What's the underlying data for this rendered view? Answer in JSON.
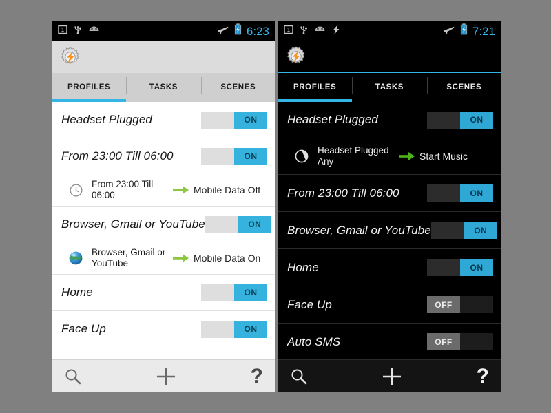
{
  "app": {
    "name": "Tasker",
    "logo_icon": "tasker-gear-bolt-icon"
  },
  "panels": [
    {
      "id": "light",
      "theme": "light",
      "status_bar": {
        "left_icons": [
          "sim-card-icon",
          "usb-icon",
          "android-debug-icon"
        ],
        "right_icons": [
          "airplane-mode-icon",
          "battery-charging-icon"
        ],
        "time": "6:23"
      },
      "tabs": [
        {
          "label": "PROFILES",
          "selected": true
        },
        {
          "label": "TASKS",
          "selected": false
        },
        {
          "label": "SCENES",
          "selected": false
        }
      ],
      "profiles": [
        {
          "name": "Headset Plugged",
          "toggle": {
            "state": "on",
            "label": "ON"
          },
          "detail": null
        },
        {
          "name": "From 23:00 Till 06:00",
          "toggle": {
            "state": "on",
            "label": "ON"
          },
          "detail": {
            "icon": "clock-icon",
            "context": "From 23:00 Till 06:00",
            "arrow_icon": "arrow-right-icon",
            "action": "Mobile Data Off"
          }
        },
        {
          "name": "Browser, Gmail or YouTube",
          "toggle": {
            "state": "on",
            "label": "ON"
          },
          "detail": {
            "icon": "globe-icon",
            "context": "Browser, Gmail or YouTube",
            "arrow_icon": "arrow-right-icon",
            "action": "Mobile Data On"
          }
        },
        {
          "name": "Home",
          "toggle": {
            "state": "on",
            "label": "ON"
          },
          "detail": null
        },
        {
          "name": "Face Up",
          "toggle": {
            "state": "on",
            "label": "ON"
          },
          "detail": null
        }
      ],
      "bottom_bar": {
        "search_icon": "search-icon",
        "add_icon": "plus-icon",
        "help_label": "?"
      }
    },
    {
      "id": "dark",
      "theme": "dark",
      "status_bar": {
        "left_icons": [
          "sim-card-icon",
          "usb-icon",
          "android-debug-icon",
          "bolt-icon"
        ],
        "right_icons": [
          "airplane-mode-icon",
          "battery-charging-icon"
        ],
        "time": "7:21"
      },
      "tabs": [
        {
          "label": "PROFILES",
          "selected": true
        },
        {
          "label": "TASKS",
          "selected": false
        },
        {
          "label": "SCENES",
          "selected": false
        }
      ],
      "profiles": [
        {
          "name": "Headset Plugged",
          "toggle": {
            "state": "on",
            "label": "ON"
          },
          "detail": {
            "icon": "half-circle-icon",
            "context": "Headset Plugged Any",
            "arrow_icon": "arrow-right-icon",
            "action": "Start Music"
          }
        },
        {
          "name": "From 23:00 Till 06:00",
          "toggle": {
            "state": "on",
            "label": "ON"
          },
          "detail": null
        },
        {
          "name": "Browser, Gmail or YouTube",
          "toggle": {
            "state": "on",
            "label": "ON"
          },
          "detail": null
        },
        {
          "name": "Home",
          "toggle": {
            "state": "on",
            "label": "ON"
          },
          "detail": null
        },
        {
          "name": "Face Up",
          "toggle": {
            "state": "off",
            "label": "OFF"
          },
          "detail": null
        },
        {
          "name": "Auto SMS",
          "toggle": {
            "state": "off",
            "label": "OFF"
          },
          "detail": null
        }
      ],
      "bottom_bar": {
        "search_icon": "search-icon",
        "add_icon": "plus-icon",
        "help_label": "?"
      }
    }
  ],
  "colors": {
    "accent_blue": "#33b5e5",
    "toggle_on": "#35b2dd",
    "toggle_off_thumb": "#9a9a9a",
    "arrow_green": "#8dc63f",
    "logo_orange": "#f7941e",
    "background_grey": "#808080"
  }
}
